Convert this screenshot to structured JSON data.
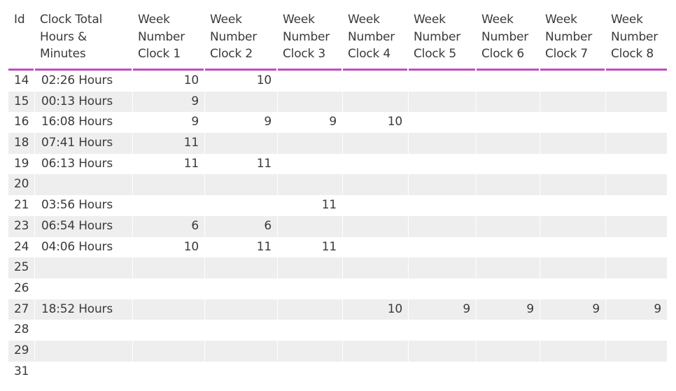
{
  "table": {
    "columns": [
      "Id",
      "Clock Total\nHours &\nMinutes",
      "Week\nNumber\nClock 1",
      "Week\nNumber\nClock 2",
      "Week\nNumber\nClock 3",
      "Week\nNumber\nClock 4",
      "Week\nNumber\nClock 5",
      "Week\nNumber\nClock 6",
      "Week\nNumber\nClock 7",
      "Week\nNumber\nClock 8"
    ],
    "header_accent_color": "#c24dbf",
    "rows": [
      {
        "id": "14",
        "total": "02:26 Hours",
        "w": [
          "10",
          "10",
          "",
          "",
          "",
          "",
          "",
          ""
        ]
      },
      {
        "id": "15",
        "total": "00:13 Hours",
        "w": [
          "9",
          "",
          "",
          "",
          "",
          "",
          "",
          ""
        ]
      },
      {
        "id": "16",
        "total": "16:08 Hours",
        "w": [
          "9",
          "9",
          "9",
          "10",
          "",
          "",
          "",
          ""
        ]
      },
      {
        "id": "18",
        "total": "07:41 Hours",
        "w": [
          "11",
          "",
          "",
          "",
          "",
          "",
          "",
          ""
        ]
      },
      {
        "id": "19",
        "total": "06:13 Hours",
        "w": [
          "11",
          "11",
          "",
          "",
          "",
          "",
          "",
          ""
        ]
      },
      {
        "id": "20",
        "total": "",
        "w": [
          "",
          "",
          "",
          "",
          "",
          "",
          "",
          ""
        ]
      },
      {
        "id": "21",
        "total": "03:56 Hours",
        "w": [
          "",
          "",
          "11",
          "",
          "",
          "",
          "",
          ""
        ]
      },
      {
        "id": "23",
        "total": "06:54 Hours",
        "w": [
          "6",
          "6",
          "",
          "",
          "",
          "",
          "",
          ""
        ]
      },
      {
        "id": "24",
        "total": "04:06 Hours",
        "w": [
          "10",
          "11",
          "11",
          "",
          "",
          "",
          "",
          ""
        ]
      },
      {
        "id": "25",
        "total": "",
        "w": [
          "",
          "",
          "",
          "",
          "",
          "",
          "",
          ""
        ]
      },
      {
        "id": "26",
        "total": "",
        "w": [
          "",
          "",
          "",
          "",
          "",
          "",
          "",
          ""
        ]
      },
      {
        "id": "27",
        "total": "18:52 Hours",
        "w": [
          "",
          "",
          "",
          "10",
          "9",
          "9",
          "9",
          "9"
        ]
      },
      {
        "id": "28",
        "total": "",
        "w": [
          "",
          "",
          "",
          "",
          "",
          "",
          "",
          ""
        ]
      },
      {
        "id": "29",
        "total": "",
        "w": [
          "",
          "",
          "",
          "",
          "",
          "",
          "",
          ""
        ]
      },
      {
        "id": "31",
        "total": "",
        "w": [
          "",
          "",
          "",
          "",
          "",
          "",
          "",
          ""
        ]
      }
    ]
  }
}
